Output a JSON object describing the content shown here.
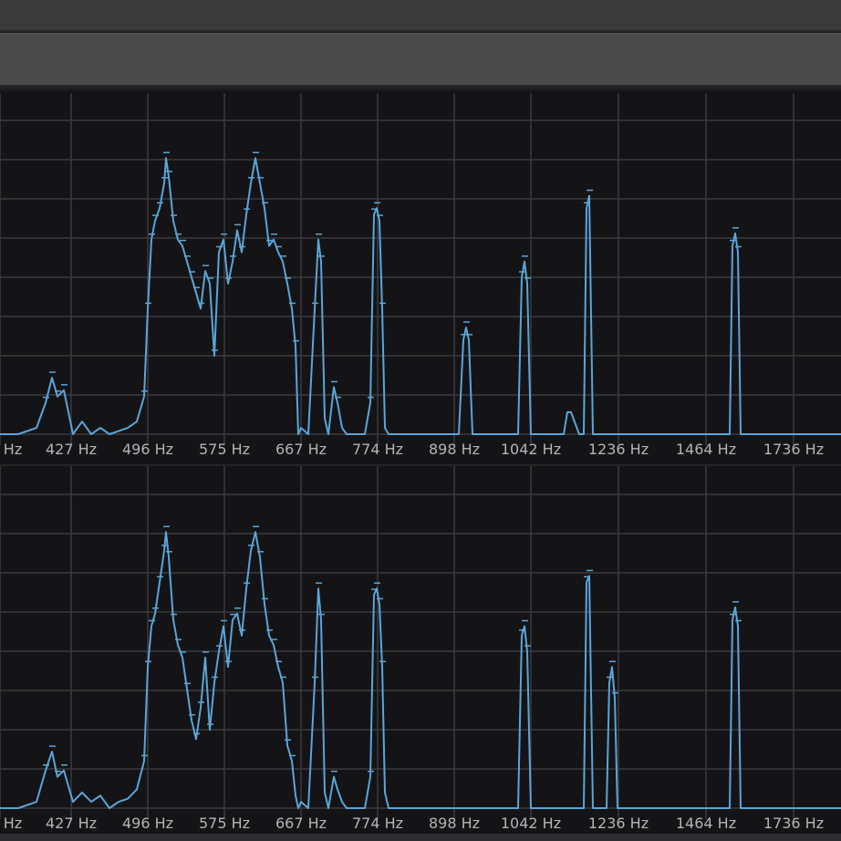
{
  "chart_data": [
    {
      "type": "line",
      "title": "",
      "xlabel": "",
      "ylabel": "",
      "tick_labels": [
        "Hz",
        "427 Hz",
        "496 Hz",
        "575 Hz",
        "667 Hz",
        "774 Hz",
        "898 Hz",
        "1042 Hz",
        "1236 Hz",
        "1464 Hz",
        "1736 Hz"
      ],
      "grid": true,
      "line_color": "#5aa5d8",
      "x": [
        0,
        20,
        40,
        50,
        57,
        63,
        70,
        80,
        90,
        100,
        110,
        120,
        130,
        140,
        150,
        158,
        162,
        166,
        170,
        175,
        180,
        182,
        185,
        190,
        195,
        200,
        205,
        210,
        215,
        220,
        225,
        230,
        235,
        240,
        245,
        250,
        255,
        260,
        265,
        270,
        275,
        280,
        285,
        290,
        295,
        300,
        305,
        310,
        315,
        320,
        324,
        327,
        330,
        338,
        345,
        349,
        352,
        356,
        360,
        366,
        370,
        375,
        380,
        400,
        406,
        410,
        413,
        416,
        419,
        422,
        426,
        430,
        440,
        480,
        503,
        508,
        511,
        514,
        518,
        540,
        568,
        572,
        575,
        578,
        582,
        600,
        618,
        622,
        626,
        635,
        640,
        643,
        646,
        650,
        680,
        800,
        803,
        806,
        809,
        812,
        830,
        922
      ],
      "y": [
        0,
        0,
        2,
        10,
        18,
        12,
        14,
        0,
        4,
        0,
        2,
        0,
        1,
        2,
        4,
        12,
        40,
        62,
        68,
        72,
        80,
        88,
        82,
        68,
        62,
        60,
        55,
        50,
        45,
        40,
        52,
        48,
        25,
        58,
        62,
        48,
        55,
        65,
        58,
        70,
        80,
        88,
        80,
        72,
        60,
        62,
        58,
        55,
        48,
        40,
        28,
        0,
        2,
        0,
        40,
        62,
        55,
        5,
        0,
        15,
        10,
        2,
        0,
        0,
        10,
        70,
        72,
        68,
        40,
        2,
        0,
        0,
        0,
        0,
        0,
        30,
        34,
        30,
        0,
        0,
        0,
        50,
        55,
        48,
        0,
        0,
        0,
        7,
        7,
        0,
        0,
        72,
        76,
        0,
        0,
        0,
        60,
        64,
        58,
        0,
        0,
        0
      ]
    },
    {
      "type": "line",
      "title": "",
      "xlabel": "",
      "ylabel": "",
      "tick_labels": [
        "Hz",
        "427 Hz",
        "496 Hz",
        "575 Hz",
        "667 Hz",
        "774 Hz",
        "898 Hz",
        "1042 Hz",
        "1236 Hz",
        "1464 Hz",
        "1736 Hz"
      ],
      "grid": true,
      "line_color": "#5aa5d8",
      "x": [
        0,
        20,
        40,
        50,
        57,
        63,
        70,
        80,
        90,
        100,
        110,
        120,
        130,
        140,
        150,
        158,
        162,
        166,
        170,
        175,
        180,
        182,
        185,
        190,
        195,
        200,
        205,
        210,
        215,
        220,
        225,
        230,
        235,
        240,
        245,
        250,
        255,
        260,
        265,
        270,
        275,
        280,
        285,
        290,
        295,
        300,
        305,
        310,
        315,
        320,
        324,
        327,
        330,
        338,
        345,
        349,
        352,
        356,
        360,
        366,
        370,
        375,
        380,
        400,
        406,
        410,
        413,
        416,
        419,
        422,
        426,
        430,
        440,
        480,
        503,
        508,
        511,
        514,
        518,
        540,
        568,
        572,
        575,
        578,
        582,
        600,
        618,
        622,
        626,
        635,
        640,
        643,
        646,
        650,
        665,
        668,
        671,
        674,
        677,
        680,
        800,
        803,
        806,
        809,
        812,
        830,
        922
      ],
      "y": [
        0,
        0,
        2,
        12,
        18,
        10,
        12,
        2,
        5,
        2,
        4,
        0,
        2,
        3,
        6,
        15,
        45,
        58,
        62,
        72,
        82,
        88,
        80,
        60,
        52,
        48,
        38,
        28,
        22,
        32,
        48,
        25,
        40,
        50,
        58,
        45,
        60,
        62,
        55,
        70,
        82,
        88,
        80,
        65,
        55,
        52,
        45,
        40,
        20,
        15,
        4,
        0,
        2,
        0,
        40,
        70,
        60,
        5,
        0,
        10,
        6,
        2,
        0,
        0,
        10,
        68,
        70,
        65,
        45,
        5,
        0,
        0,
        0,
        0,
        0,
        0,
        0,
        0,
        0,
        0,
        0,
        55,
        58,
        50,
        0,
        0,
        0,
        0,
        0,
        0,
        0,
        72,
        74,
        0,
        0,
        40,
        45,
        35,
        0,
        0,
        0,
        60,
        64,
        58,
        0,
        0,
        0
      ]
    }
  ]
}
